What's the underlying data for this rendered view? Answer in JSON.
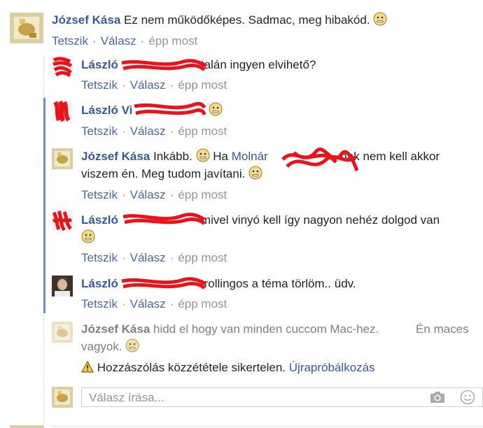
{
  "colors": {
    "link": "#365899",
    "action": "#4b67a1",
    "meta": "#90949c",
    "thread_line": "#6d8ec6",
    "redaction": "#e8141c"
  },
  "actions": {
    "like": "Tetszik",
    "reply": "Válasz",
    "separator": "·",
    "time": "épp most"
  },
  "comments": [
    {
      "author": "József Kása",
      "text": "Ez nem működőképes. Sadmac, meg hibakód.",
      "emoji": "neutral-face"
    },
    {
      "author": "László",
      "text": "talán ingyen elvihető?"
    },
    {
      "author": "László Vi",
      "text": "",
      "emoji": "neutral-face"
    },
    {
      "author": "József Kása",
      "text_before": "Inkább.",
      "text_ha": "Ha",
      "mention": "Molnár",
      "text_after": "-nak nem kell akkor",
      "line2": "viszem én. Meg tudom javítani."
    },
    {
      "author": "László",
      "text": "mivel vinyó kell így nagyon nehéz dolgod van"
    },
    {
      "author": "László",
      "text": "trollingos a téma törlöm.. üdv."
    },
    {
      "author": "József Kása",
      "text": "hidd el hogy van minden cuccom Mac-hez.",
      "text_right": "Én maces",
      "line2": "vagyok."
    }
  ],
  "failed_post": {
    "icon": "warning-icon",
    "message": "Hozzászólás közzététele sikertelen.",
    "retry": "Újrapróbálkozás"
  },
  "reply_input": {
    "placeholder": "Válasz írása...",
    "camera_icon": "camera-icon",
    "emoji_icon": "smiley-icon"
  }
}
